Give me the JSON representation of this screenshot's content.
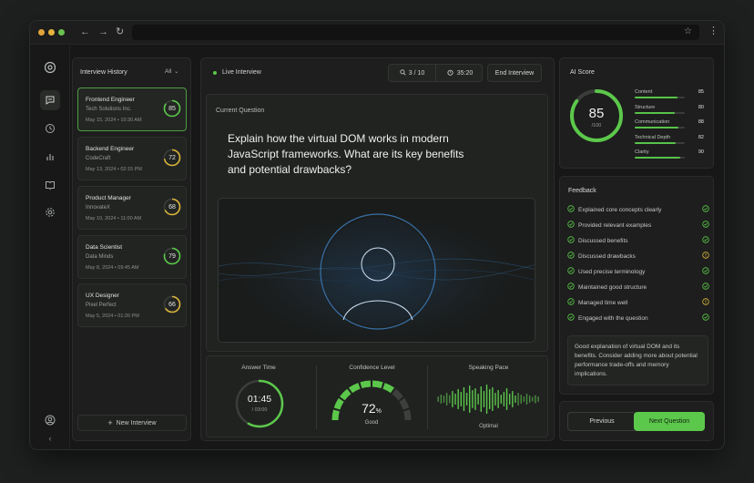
{
  "browser": {
    "url": ""
  },
  "history": {
    "title": "Interview History",
    "filter": "All",
    "items": [
      {
        "role": "Frontend Engineer",
        "company": "Tech Solutions Inc.",
        "date": "May 15, 2024",
        "time": "10:30 AM",
        "score": "85",
        "score_value": 85,
        "color": "#5cc84b",
        "active": true
      },
      {
        "role": "Backend Engineer",
        "company": "CodeCraft",
        "date": "May 13, 2024",
        "time": "02:15 PM",
        "score": "72",
        "score_value": 72,
        "color": "#d9b43a",
        "active": false
      },
      {
        "role": "Product Manager",
        "company": "InnovateX",
        "date": "May 10, 2024",
        "time": "11:00 AM",
        "score": "68",
        "score_value": 68,
        "color": "#d9b43a",
        "active": false
      },
      {
        "role": "Data Scientist",
        "company": "Data Minds",
        "date": "May 8, 2024",
        "time": "09:45 AM",
        "score": "79",
        "score_value": 79,
        "color": "#5cc84b",
        "active": false
      },
      {
        "role": "UX Designer",
        "company": "Pixel Perfect",
        "date": "May 5, 2024",
        "time": "01:20 PM",
        "score": "66",
        "score_value": 66,
        "color": "#d9b43a",
        "active": false
      }
    ],
    "new_button": "New Interview"
  },
  "live": {
    "label": "Live Interview",
    "question_counter": "3 / 10",
    "timer": "35:20",
    "end_button": "End Interview"
  },
  "question": {
    "label": "Current Question",
    "text": "Explain how the virtual DOM works in modern JavaScript frameworks. What are its key benefits and potential drawbacks?"
  },
  "stats": {
    "answer_time": {
      "label": "Answer Time",
      "value": "01:45",
      "total": "/ 03:00",
      "progress": 0.58
    },
    "confidence": {
      "label": "Confidence Level",
      "value": "72",
      "unit": "%",
      "rating": "Good",
      "level": 0.72
    },
    "pace": {
      "label": "Speaking Pace",
      "rating": "Optimal"
    }
  },
  "ai_score": {
    "title": "AI Score",
    "score": "85",
    "score_value": 85,
    "total": "/100",
    "metrics": [
      {
        "label": "Content",
        "value": "85",
        "level": 85
      },
      {
        "label": "Structure",
        "value": "80",
        "level": 80
      },
      {
        "label": "Communication",
        "value": "88",
        "level": 88
      },
      {
        "label": "Technical Depth",
        "value": "82",
        "level": 82
      },
      {
        "label": "Clarity",
        "value": "90",
        "level": 90
      }
    ]
  },
  "feedback": {
    "title": "Feedback",
    "items": [
      {
        "text": "Explained core concepts clearly",
        "status": "good"
      },
      {
        "text": "Provided relevant examples",
        "status": "good"
      },
      {
        "text": "Discussed benefits",
        "status": "good"
      },
      {
        "text": "Discussed drawbacks",
        "status": "warn"
      },
      {
        "text": "Used precise terminology",
        "status": "good"
      },
      {
        "text": "Maintained good structure",
        "status": "good"
      },
      {
        "text": "Managed time well",
        "status": "warn"
      },
      {
        "text": "Engaged with the question",
        "status": "good"
      }
    ],
    "summary": "Good explanation of virtual DOM and its benefits. Consider adding more about potential performance trade-offs and memory implications."
  },
  "nav": {
    "previous": "Previous",
    "next": "Next Question"
  },
  "colors": {
    "accent": "#5cc84b",
    "warn": "#d9b43a",
    "background": "#161716"
  }
}
